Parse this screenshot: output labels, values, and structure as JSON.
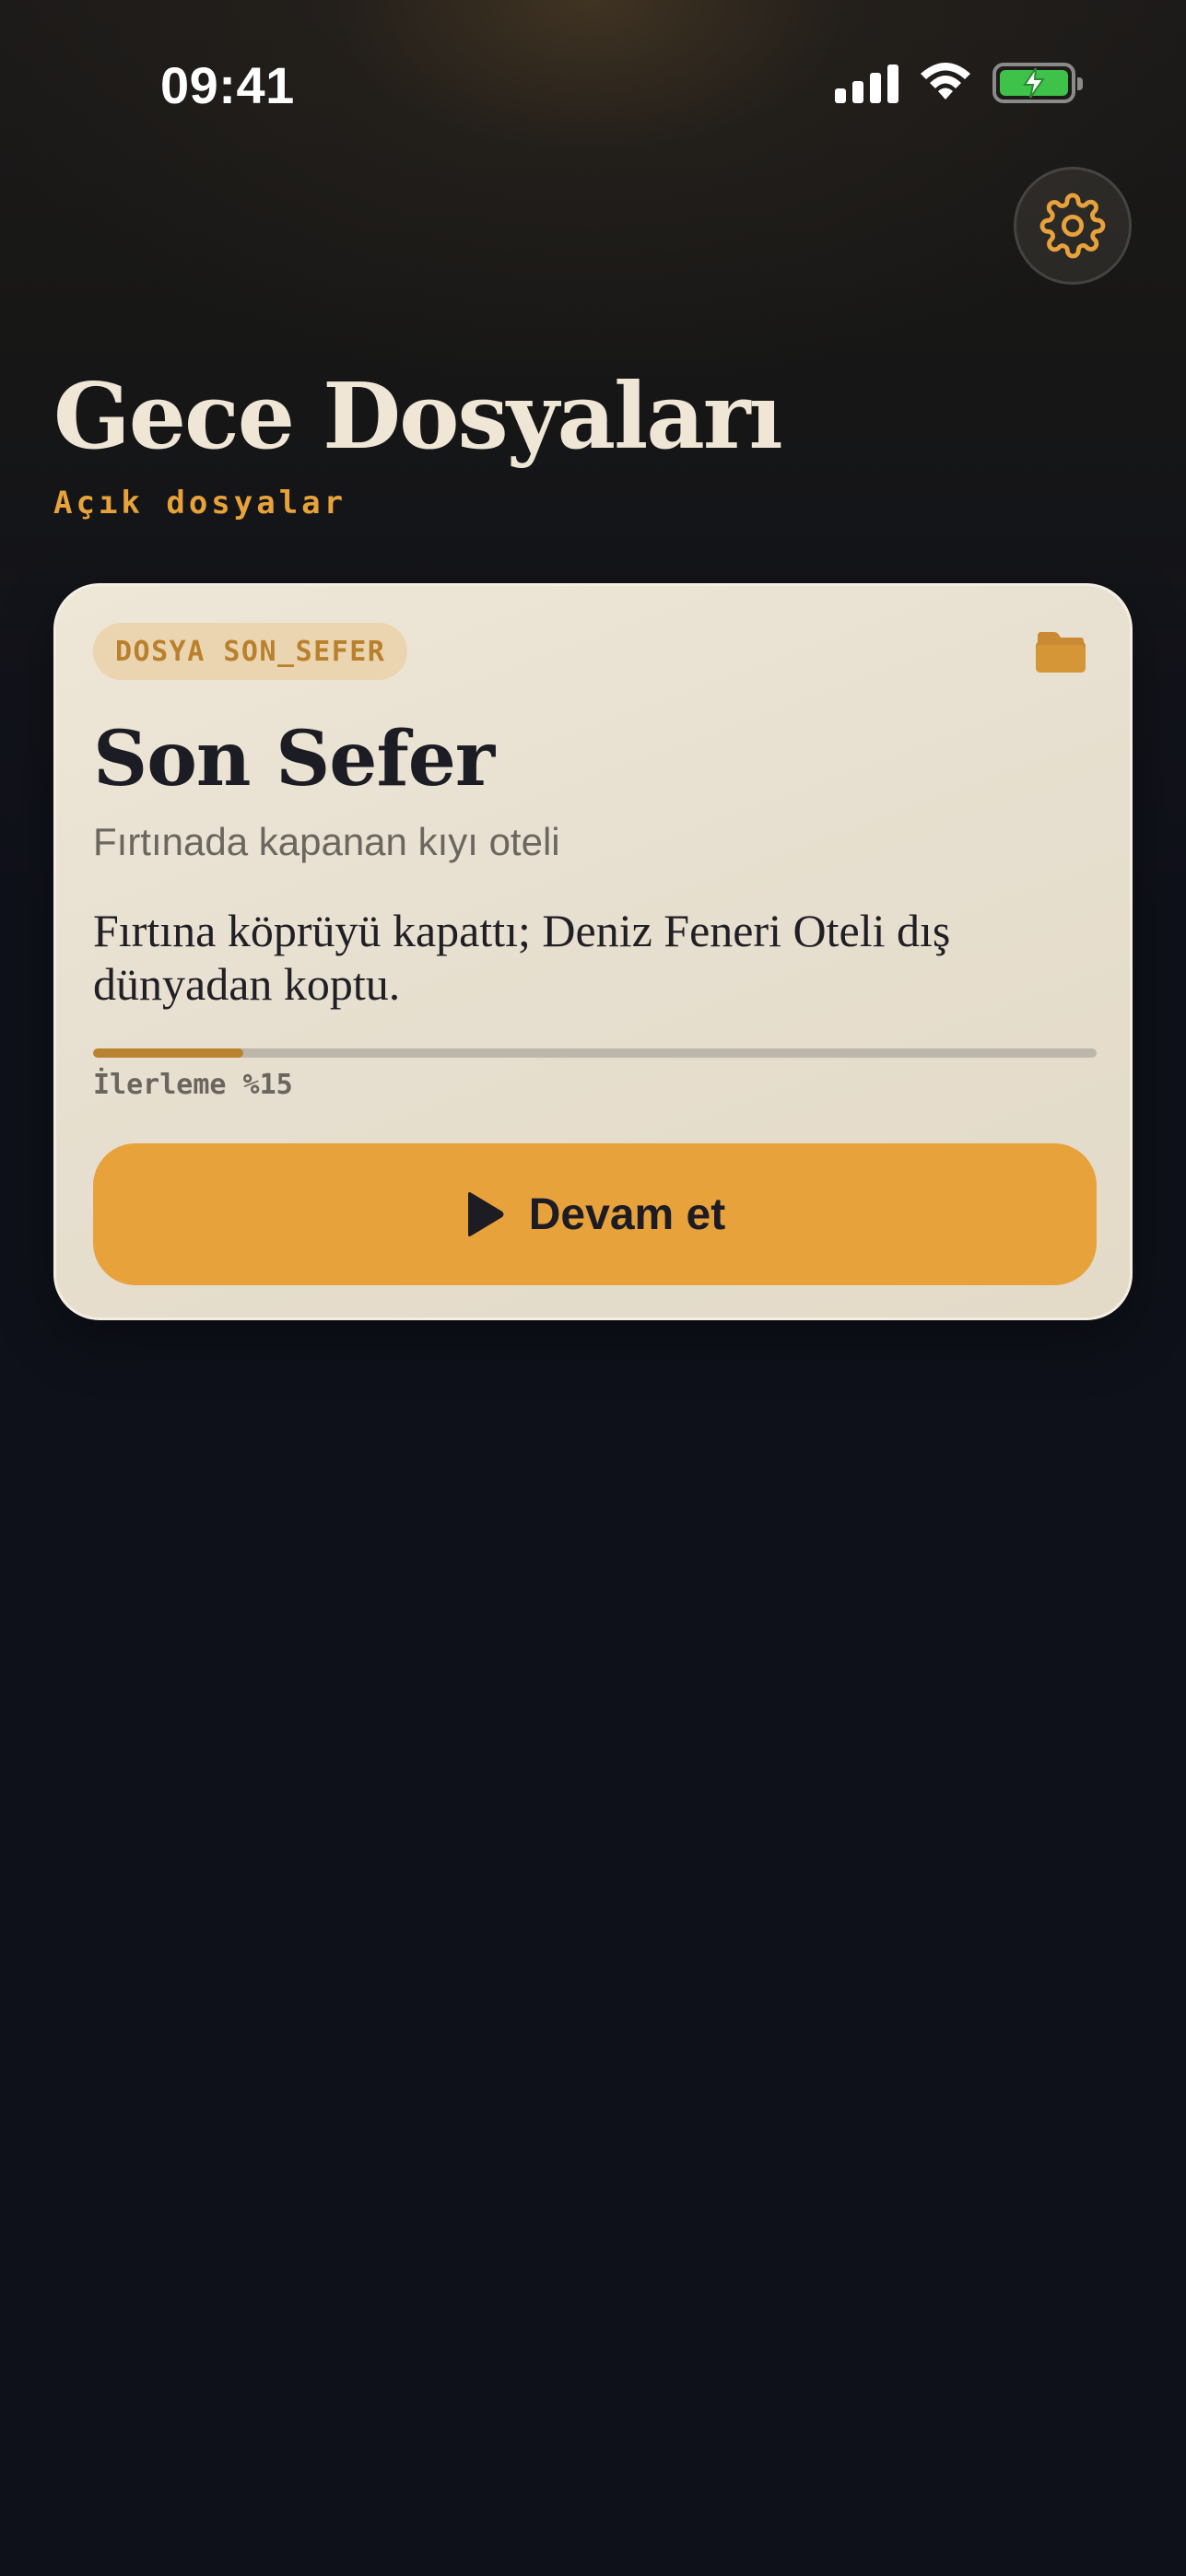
{
  "status_bar": {
    "time": "09:41",
    "signal_icon": "cellular-signal-icon",
    "wifi_icon": "wifi-icon",
    "battery_icon": "battery-charging-icon",
    "battery_color": "#3fc24a"
  },
  "header": {
    "settings_icon": "gear-icon",
    "title": "Gece Dosyaları",
    "subtitle": "Açık dosyalar"
  },
  "case_card": {
    "tag": "DOSYA SON_SEFER",
    "folder_icon": "folder-icon",
    "title": "Son Sefer",
    "subtitle": "Fırtınada kapanan kıyı oteli",
    "description": "Fırtına köprüyü kapattı; Deniz Feneri Oteli dış dünyadan koptu.",
    "progress_percent": 15,
    "progress_label": "İlerleme %15",
    "button_icon": "play-icon",
    "button_label": "Devam et"
  },
  "colors": {
    "accent": "#e8a23c",
    "background": "#0f111a",
    "card": "#e7dfcf",
    "title_text": "#efe6d6"
  }
}
